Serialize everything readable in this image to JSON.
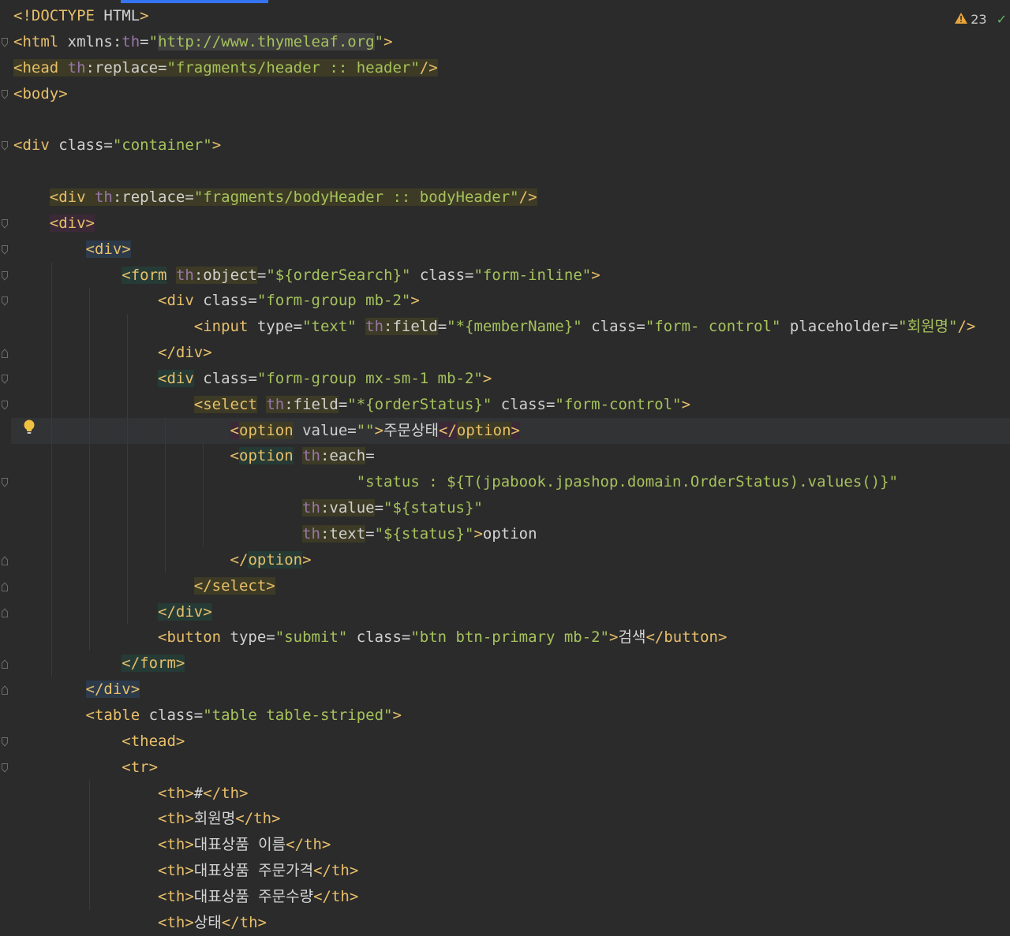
{
  "inspection": {
    "warning_count": "23"
  },
  "code_lines": [
    [
      [
        "t",
        "",
        "<!DOCTYPE "
      ],
      [
        "x",
        "",
        "HTML"
      ],
      [
        "t",
        "",
        ">"
      ]
    ],
    [
      [
        "t",
        "",
        "<html "
      ],
      [
        "a",
        "",
        "xmlns:"
      ],
      [
        "ns",
        "",
        "th"
      ],
      [
        "a",
        "",
        "="
      ],
      [
        "v",
        "",
        "\""
      ],
      [
        "v",
        "hgr",
        "http://www.thymeleaf.org"
      ],
      [
        "v",
        "",
        "\""
      ],
      [
        "t",
        "",
        ">"
      ]
    ],
    [
      [
        "t",
        "hb",
        "<head "
      ],
      [
        "ns",
        "hb",
        "th"
      ],
      [
        "a",
        "hb",
        ":replace="
      ],
      [
        "v",
        "hb",
        "\"fragments/header :: header\""
      ],
      [
        "t",
        "hb",
        "/>"
      ]
    ],
    [
      [
        "t",
        "",
        "<body>"
      ]
    ],
    [],
    [
      [
        "t",
        "",
        "<div "
      ],
      [
        "a",
        "",
        "class="
      ],
      [
        "v",
        "",
        "\"container\""
      ],
      [
        "t",
        "",
        ">"
      ]
    ],
    [],
    [
      [
        "x",
        "",
        "    "
      ],
      [
        "t",
        "hb",
        "<div "
      ],
      [
        "ns",
        "hb",
        "th"
      ],
      [
        "a",
        "hb",
        ":replace="
      ],
      [
        "v",
        "hb",
        "\"fragments/bodyHeader :: bodyHeader\""
      ],
      [
        "t",
        "hb",
        "/>"
      ]
    ],
    [
      [
        "x",
        "",
        "    "
      ],
      [
        "t",
        "hr",
        "<div>"
      ]
    ],
    [
      [
        "x",
        "",
        "        "
      ],
      [
        "t",
        "hbl",
        "<div>"
      ]
    ],
    [
      [
        "x",
        "",
        "            "
      ],
      [
        "t",
        "hg",
        "<form"
      ],
      [
        "x",
        "",
        " "
      ],
      [
        "ns",
        "hb",
        "th"
      ],
      [
        "a",
        "hb",
        ":object"
      ],
      [
        "a",
        "",
        "="
      ],
      [
        "v",
        "",
        "\"${orderSearch}\""
      ],
      [
        "x",
        "",
        " "
      ],
      [
        "a",
        "",
        "class="
      ],
      [
        "v",
        "",
        "\"form-inline\""
      ],
      [
        "t",
        "",
        ">"
      ]
    ],
    [
      [
        "x",
        "",
        "                "
      ],
      [
        "t",
        "",
        "<div "
      ],
      [
        "a",
        "",
        "class="
      ],
      [
        "v",
        "",
        "\"form-group mb-2\""
      ],
      [
        "t",
        "",
        ">"
      ]
    ],
    [
      [
        "x",
        "",
        "                    "
      ],
      [
        "t",
        "",
        "<input "
      ],
      [
        "a",
        "",
        "type="
      ],
      [
        "v",
        "",
        "\"text\""
      ],
      [
        "x",
        "",
        " "
      ],
      [
        "ns",
        "hb",
        "th"
      ],
      [
        "a",
        "hb",
        ":field"
      ],
      [
        "a",
        "",
        "="
      ],
      [
        "v",
        "",
        "\"*{memberName}\""
      ],
      [
        "x",
        "",
        " "
      ],
      [
        "a",
        "",
        "class="
      ],
      [
        "v",
        "",
        "\"form- control\""
      ],
      [
        "x",
        "",
        " "
      ],
      [
        "a",
        "",
        "placeholder="
      ],
      [
        "v",
        "",
        "\"회원명\""
      ],
      [
        "t",
        "",
        "/>"
      ]
    ],
    [
      [
        "x",
        "",
        "                "
      ],
      [
        "t",
        "",
        "</div>"
      ]
    ],
    [
      [
        "x",
        "",
        "                "
      ],
      [
        "t",
        "hg",
        "<div"
      ],
      [
        "x",
        "",
        " "
      ],
      [
        "a",
        "",
        "class="
      ],
      [
        "v",
        "",
        "\"form-group mx-sm-1 mb-2\""
      ],
      [
        "t",
        "",
        ">"
      ]
    ],
    [
      [
        "x",
        "",
        "                    "
      ],
      [
        "t",
        "hb",
        "<select"
      ],
      [
        "x",
        "",
        " "
      ],
      [
        "ns",
        "hb",
        "th"
      ],
      [
        "a",
        "hb",
        ":field"
      ],
      [
        "a",
        "",
        "="
      ],
      [
        "v",
        "",
        "\"*{orderStatus}\""
      ],
      [
        "x",
        "",
        " "
      ],
      [
        "a",
        "",
        "class="
      ],
      [
        "v",
        "",
        "\"form-control\""
      ],
      [
        "t",
        "",
        ">"
      ]
    ],
    [
      [
        "x",
        "",
        "                        "
      ],
      [
        "t",
        "hr",
        "<"
      ],
      [
        "t",
        "hb",
        "option"
      ],
      [
        "x",
        "",
        " "
      ],
      [
        "a",
        "",
        "value="
      ],
      [
        "v",
        "",
        "\"\""
      ],
      [
        "t",
        "",
        ">"
      ],
      [
        "x",
        "",
        "주문상태"
      ],
      [
        "t",
        "hr",
        "</"
      ],
      [
        "t",
        "hb",
        "option"
      ],
      [
        "t",
        "hr",
        ">"
      ]
    ],
    [
      [
        "x",
        "",
        "                        "
      ],
      [
        "t",
        "",
        "<"
      ],
      [
        "t",
        "hg",
        "option"
      ],
      [
        "x",
        "",
        " "
      ],
      [
        "ns",
        "hb",
        "th"
      ],
      [
        "a",
        "hb",
        ":each"
      ],
      [
        "a",
        "",
        "="
      ]
    ],
    [
      [
        "x",
        "",
        "                                      "
      ],
      [
        "v",
        "",
        "\"status : ${T(jpabook.jpashop.domain.OrderStatus).values()}\""
      ]
    ],
    [
      [
        "x",
        "",
        "                                "
      ],
      [
        "ns",
        "hb",
        "th"
      ],
      [
        "a",
        "hb",
        ":value"
      ],
      [
        "a",
        "",
        "="
      ],
      [
        "v",
        "",
        "\"${status}\""
      ]
    ],
    [
      [
        "x",
        "",
        "                                "
      ],
      [
        "ns",
        "hb",
        "th"
      ],
      [
        "a",
        "hb",
        ":text"
      ],
      [
        "a",
        "",
        "="
      ],
      [
        "v",
        "",
        "\"${status}\""
      ],
      [
        "t",
        "",
        ">"
      ],
      [
        "x",
        "",
        "option"
      ]
    ],
    [
      [
        "x",
        "",
        "                        "
      ],
      [
        "t",
        "",
        "</"
      ],
      [
        "t",
        "hg",
        "option"
      ],
      [
        "t",
        "",
        ">"
      ]
    ],
    [
      [
        "x",
        "",
        "                    "
      ],
      [
        "t",
        "hb",
        "</select>"
      ]
    ],
    [
      [
        "x",
        "",
        "                "
      ],
      [
        "t",
        "hg",
        "</div>"
      ]
    ],
    [
      [
        "x",
        "",
        "                "
      ],
      [
        "t",
        "",
        "<button "
      ],
      [
        "a",
        "",
        "type="
      ],
      [
        "v",
        "",
        "\"submit\""
      ],
      [
        "x",
        "",
        " "
      ],
      [
        "a",
        "",
        "class="
      ],
      [
        "v",
        "",
        "\"btn btn-primary mb-2\""
      ],
      [
        "t",
        "",
        ">"
      ],
      [
        "x",
        "",
        "검색"
      ],
      [
        "t",
        "",
        "</button>"
      ]
    ],
    [
      [
        "x",
        "",
        "            "
      ],
      [
        "t",
        "hg",
        "</form>"
      ]
    ],
    [
      [
        "x",
        "",
        "        "
      ],
      [
        "t",
        "hbl",
        "</div>"
      ]
    ],
    [
      [
        "x",
        "",
        "        "
      ],
      [
        "t",
        "",
        "<table "
      ],
      [
        "a",
        "",
        "class="
      ],
      [
        "v",
        "",
        "\"table table-striped\""
      ],
      [
        "t",
        "",
        ">"
      ]
    ],
    [
      [
        "x",
        "",
        "            "
      ],
      [
        "t",
        "",
        "<thead>"
      ]
    ],
    [
      [
        "x",
        "",
        "            "
      ],
      [
        "t",
        "",
        "<tr>"
      ]
    ],
    [
      [
        "x",
        "",
        "                "
      ],
      [
        "t",
        "",
        "<th>"
      ],
      [
        "x",
        "",
        "#"
      ],
      [
        "t",
        "",
        "</th>"
      ]
    ],
    [
      [
        "x",
        "",
        "                "
      ],
      [
        "t",
        "",
        "<th>"
      ],
      [
        "x",
        "",
        "회원명"
      ],
      [
        "t",
        "",
        "</th>"
      ]
    ],
    [
      [
        "x",
        "",
        "                "
      ],
      [
        "t",
        "",
        "<th>"
      ],
      [
        "x",
        "",
        "대표상품 이름"
      ],
      [
        "t",
        "",
        "</th>"
      ]
    ],
    [
      [
        "x",
        "",
        "                "
      ],
      [
        "t",
        "",
        "<th>"
      ],
      [
        "x",
        "",
        "대표상품 주문가격"
      ],
      [
        "t",
        "",
        "</th>"
      ]
    ],
    [
      [
        "x",
        "",
        "                "
      ],
      [
        "t",
        "",
        "<th>"
      ],
      [
        "x",
        "",
        "대표상품 주문수량"
      ],
      [
        "t",
        "",
        "</th>"
      ]
    ],
    [
      [
        "x",
        "",
        "                "
      ],
      [
        "t",
        "",
        "<th>"
      ],
      [
        "x",
        "",
        "상태"
      ],
      [
        "t",
        "",
        "</th>"
      ]
    ]
  ]
}
